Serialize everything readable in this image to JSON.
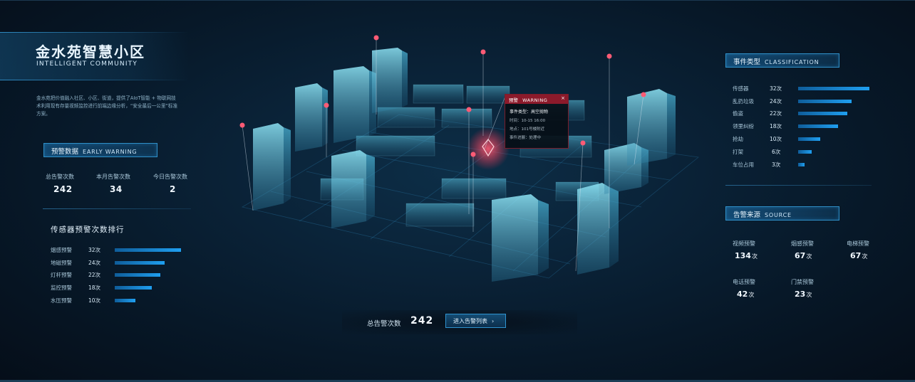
{
  "header": {
    "title": "金水苑智慧小区",
    "subtitle": "INTELLIGENT COMMUNITY",
    "intro": "金水苑把价值融入社区、小区、街道，提供了AIoT智能 + 物联网技术利用现有存量视频监控进行前端边缘分析，“安全最后一公里”标准方案。"
  },
  "early_warning": {
    "title_cn": "预警数据",
    "title_en": "EARLY WARNING",
    "stats": [
      {
        "label": "总告警次数",
        "value": "242"
      },
      {
        "label": "本月告警次数",
        "value": "34"
      },
      {
        "label": "今日告警次数",
        "value": "2"
      }
    ]
  },
  "sensor_rank": {
    "title": "传感器预警次数排行",
    "max": 32,
    "items": [
      {
        "name": "烟感预警",
        "count_text": "32次",
        "count": 32
      },
      {
        "name": "地磁预警",
        "count_text": "24次",
        "count": 24
      },
      {
        "name": "灯杆预警",
        "count_text": "22次",
        "count": 22
      },
      {
        "name": "监控预警",
        "count_text": "18次",
        "count": 18
      },
      {
        "name": "水压预警",
        "count_text": "10次",
        "count": 10
      }
    ]
  },
  "popup": {
    "title_cn": "预警",
    "title_en": "WARNING",
    "close": "×",
    "event": "事件类型：高空抛物",
    "time": "时间：10-15 16:00",
    "location": "地点：101号楼附近",
    "progress": "事件进展：处理中"
  },
  "footer": {
    "total_label": "总告警次数",
    "total_value": "242",
    "button_label": "进入告警列表",
    "button_icon": "chevron-right-icon"
  },
  "classification": {
    "title_cn": "事件类型",
    "title_en": "CLASSIFICATION",
    "max": 32,
    "items": [
      {
        "name": "传感器",
        "count_text": "32次",
        "count": 32
      },
      {
        "name": "乱扔垃圾",
        "count_text": "24次",
        "count": 24
      },
      {
        "name": "偷盗",
        "count_text": "22次",
        "count": 22
      },
      {
        "name": "领里纠纷",
        "count_text": "18次",
        "count": 18
      },
      {
        "name": "抢劫",
        "count_text": "10次",
        "count": 10
      },
      {
        "name": "打架",
        "count_text": "6次",
        "count": 6
      },
      {
        "name": "车位占用",
        "count_text": "3次",
        "count": 3
      }
    ]
  },
  "source": {
    "title_cn": "告警来源",
    "title_en": "SOURCE",
    "unit": "次",
    "items": [
      {
        "label": "视频预警",
        "value": "134"
      },
      {
        "label": "烟感预警",
        "value": "67"
      },
      {
        "label": "电梯预警",
        "value": "67"
      },
      {
        "label": "电话预警",
        "value": "42"
      },
      {
        "label": "门禁预警",
        "value": "23"
      }
    ]
  },
  "colors": {
    "accent": "#1f9ff0",
    "alert": "#e8465f",
    "building": "#6fd3ec"
  }
}
